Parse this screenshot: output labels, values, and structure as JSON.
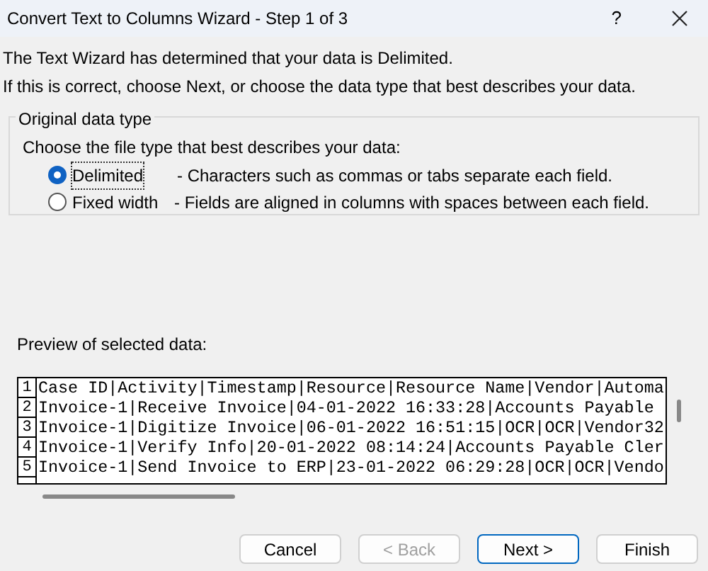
{
  "window": {
    "title": "Convert Text to Columns Wizard - Step 1 of 3",
    "help": "?"
  },
  "intro": [
    "The Text Wizard has determined that your data is Delimited.",
    "If this is correct, choose Next, or choose the data type that best describes your data."
  ],
  "group": {
    "title": "Original data type",
    "prompt": "Choose the file type that best describes your data:",
    "options": [
      {
        "label": "Delimited",
        "description": "- Characters such as commas or tabs separate each field.",
        "selected": true
      },
      {
        "label": "Fixed width",
        "description": "- Fields are aligned in columns with spaces between each field.",
        "selected": false
      }
    ]
  },
  "preview": {
    "label": "Preview of selected data:",
    "rows": [
      {
        "number": "1",
        "text": "Case ID|Activity|Timestamp|Resource|Resource Name|Vendor|Automa"
      },
      {
        "number": "2",
        "text": "Invoice-1|Receive Invoice|04-01-2022 16:33:28|Accounts Payable"
      },
      {
        "number": "3",
        "text": "Invoice-1|Digitize Invoice|06-01-2022 16:51:15|OCR|OCR|Vendor32"
      },
      {
        "number": "4",
        "text": "Invoice-1|Verify Info|20-01-2022 08:14:24|Accounts Payable Cler"
      },
      {
        "number": "5",
        "text": "Invoice-1|Send Invoice to ERP|23-01-2022 06:29:28|OCR|OCR|Vendo"
      }
    ]
  },
  "buttons": [
    {
      "label": "Cancel",
      "disabled": false,
      "default": false
    },
    {
      "label": "< Back",
      "disabled": true,
      "default": false
    },
    {
      "label": "Next >",
      "disabled": false,
      "default": true
    },
    {
      "label": "Finish",
      "disabled": false,
      "default": false
    }
  ]
}
